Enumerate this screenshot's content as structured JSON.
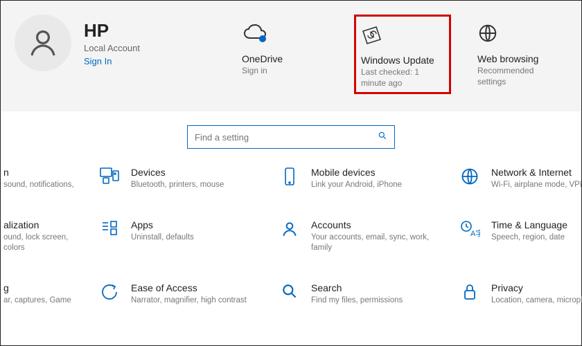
{
  "account": {
    "name": "HP",
    "type": "Local Account",
    "signin_label": "Sign In"
  },
  "tiles": {
    "onedrive": {
      "title": "OneDrive",
      "sub": "Sign in"
    },
    "windows_update": {
      "title": "Windows Update",
      "sub": "Last checked: 1 minute ago"
    },
    "web_browsing": {
      "title": "Web browsing",
      "sub": "Recommended settings"
    }
  },
  "search": {
    "placeholder": "Find a setting"
  },
  "left_partials": {
    "row1": {
      "title": "n",
      "sub": "sound, notifications,"
    },
    "row2": {
      "title": "alization",
      "sub": "ound, lock screen, colors"
    },
    "row3": {
      "title": "g",
      "sub": "ar, captures, Game"
    }
  },
  "cats": {
    "devices": {
      "title": "Devices",
      "sub": "Bluetooth, printers, mouse"
    },
    "mobile": {
      "title": "Mobile devices",
      "sub": "Link your Android, iPhone"
    },
    "network": {
      "title": "Network & Internet",
      "sub": "Wi-Fi, airplane mode, VPN"
    },
    "apps": {
      "title": "Apps",
      "sub": "Uninstall, defaults"
    },
    "accounts": {
      "title": "Accounts",
      "sub": "Your accounts, email, sync, work, family"
    },
    "time": {
      "title": "Time & Language",
      "sub": "Speech, region, date"
    },
    "ease": {
      "title": "Ease of Access",
      "sub": "Narrator, magnifier, high contrast"
    },
    "search_cat": {
      "title": "Search",
      "sub": "Find my files, permissions"
    },
    "privacy": {
      "title": "Privacy",
      "sub": "Location, camera, microphone"
    }
  }
}
